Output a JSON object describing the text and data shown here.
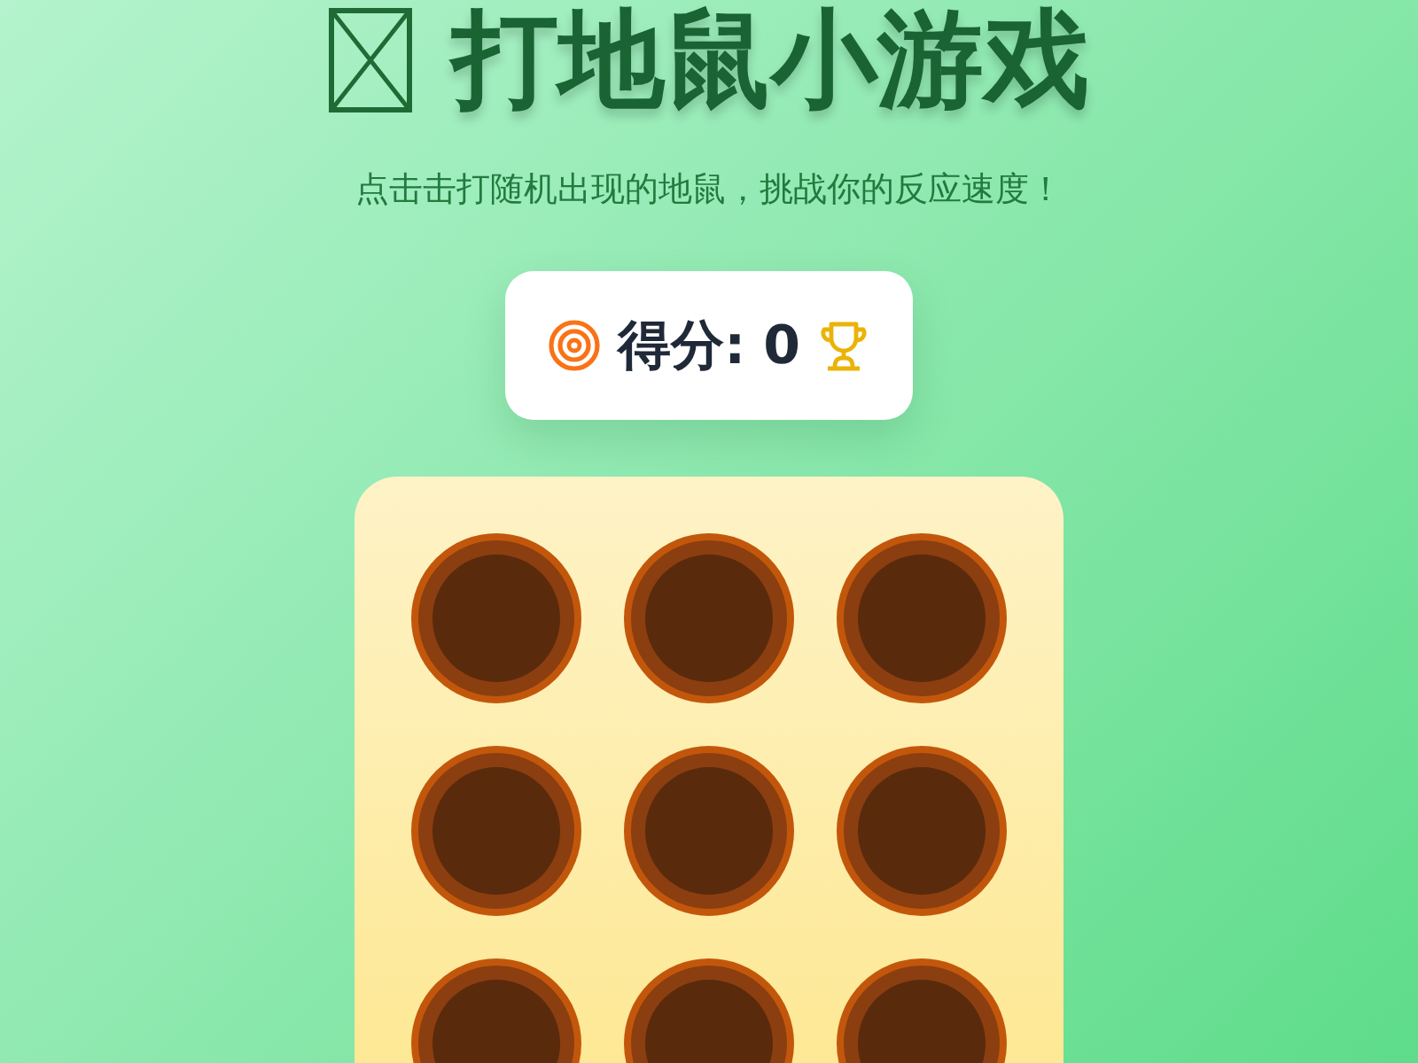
{
  "header": {
    "title": "打地鼠小游戏",
    "subtitle": "点击击打随机出现的地鼠，挑战你的反应速度！"
  },
  "score": {
    "label": "得分:",
    "value": "0"
  },
  "board": {
    "holes": [
      {
        "mole": false
      },
      {
        "mole": false
      },
      {
        "mole": false
      },
      {
        "mole": false
      },
      {
        "mole": false
      },
      {
        "mole": false
      },
      {
        "mole": false
      },
      {
        "mole": false
      },
      {
        "mole": false
      }
    ]
  }
}
